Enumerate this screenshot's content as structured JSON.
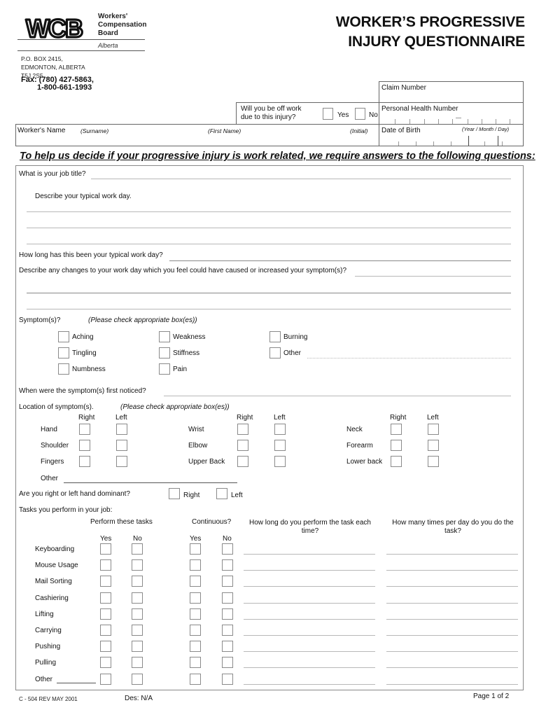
{
  "header": {
    "logo_text": "WCB",
    "org_lines": [
      "Workers'",
      "Compensation",
      "Board"
    ],
    "province": "Alberta",
    "address_lines": [
      "P.O. BOX 2415,",
      "EDMONTON, ALBERTA",
      "T5J 2S5"
    ],
    "fax_lines": [
      "Fax: (780) 427-5863,",
      "1-800-661-1993"
    ],
    "title_lines": [
      "WORKER’S PROGRESSIVE",
      "INJURY QUESTIONNAIRE"
    ]
  },
  "id_fields": {
    "claim_number": "Claim Number",
    "off_work_question": [
      "Will you be off work",
      "due to this injury?"
    ],
    "off_work_options": [
      "Yes",
      "No"
    ],
    "phn": "Personal Health Number",
    "workers_name": "Worker's Name",
    "surname": "(Surname)",
    "first_name": "(First Name)",
    "initial": "(Initial)",
    "dob": "Date of Birth",
    "dob_format": "(Year / Month / Day)"
  },
  "intro": "To help us decide if your progressive injury is work related, we require answers to the following questions:",
  "questions": {
    "job_title": "What is your job title?",
    "typical_day": "Describe your typical work day.",
    "how_long": "How long has this been your typical work day?",
    "changes": "Describe any changes to your work day which you feel could have caused or increased your symptom(s)?",
    "symptoms": "Symptom(s)?",
    "check_note": "(Please check  appropriate box(es))",
    "first_noticed": "When were the symptom(s) first noticed?",
    "location": "Location of symptom(s).",
    "other": "Other",
    "dominant": "Are you right or left hand dominant?",
    "dominant_options": [
      "Right",
      "Left"
    ],
    "tasks": "Tasks you perform in your job:"
  },
  "symptoms": [
    [
      "Aching",
      "Weakness",
      "Burning"
    ],
    [
      "Tingling",
      "Stiffness",
      "Other"
    ],
    [
      "Numbness",
      "Pain"
    ]
  ],
  "location": {
    "side_headers": [
      "Right",
      "Left"
    ],
    "columns": [
      [
        "Hand",
        "Shoulder",
        "Fingers"
      ],
      [
        "Wrist",
        "Elbow",
        "Upper Back"
      ],
      [
        "Neck",
        "Forearm",
        "Lower back"
      ]
    ]
  },
  "tasks": {
    "perform_header": "Perform these tasks",
    "continuous_header": "Continuous?",
    "duration_header": [
      "How long do you perform the task each",
      "time?"
    ],
    "frequency_header": [
      "How many times per day do you do the",
      "task?"
    ],
    "yes": "Yes",
    "no": "No",
    "rows": [
      "Keyboarding",
      "Mouse Usage",
      "Mail Sorting",
      "Cashiering",
      "Lifting",
      "Carrying",
      "Pushing",
      "Pulling",
      "Other"
    ]
  },
  "footer": {
    "form_code": "C - 504 REV MAY 2001",
    "des": "Des:  N/A",
    "page": "Page 1 of 2"
  }
}
